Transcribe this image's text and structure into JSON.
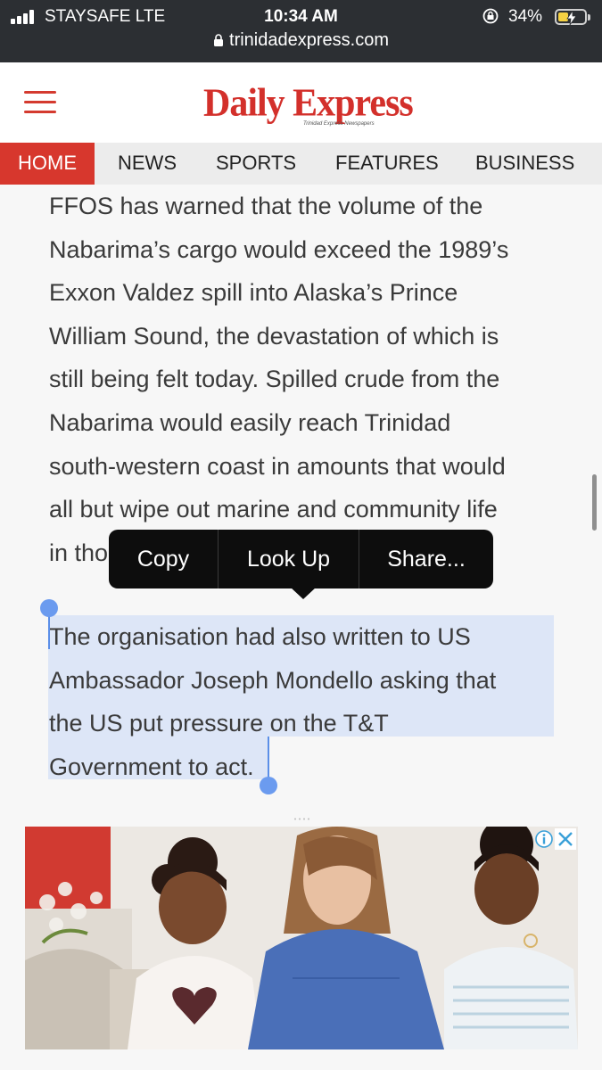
{
  "status_bar": {
    "carrier": "STAYSAFE  LTE",
    "time": "10:34 AM",
    "battery_percent": "34%",
    "battery_level": 0.34,
    "url": "trinidadexpress.com",
    "icons": [
      "signal-icon",
      "rotation-lock-icon",
      "battery-charging-icon",
      "padlock-icon"
    ]
  },
  "header": {
    "logo_text": "Daily Express",
    "logo_tagline": "Trinidad Express Newspapers",
    "menu_icon": "hamburger-icon",
    "brand_color": "#d3302b"
  },
  "nav": {
    "tabs": [
      {
        "label": "HOME",
        "active": true
      },
      {
        "label": "NEWS",
        "active": false
      },
      {
        "label": "SPORTS",
        "active": false
      },
      {
        "label": "FEATURES",
        "active": false
      },
      {
        "label": "BUSINESS",
        "active": false
      }
    ]
  },
  "article": {
    "paragraph1_lines": [
      "FFOS has warned that the volume of the",
      "Nabarima’s cargo would exceed the 1989’s",
      "Exxon Valdez spill into Alaska’s Prince",
      "William Sound, the devastation of which is",
      "still being felt today. Spilled crude from the",
      "Nabarima would easily reach Trinidad",
      "south-western coast in amounts that would",
      "all but wipe out marine and community life",
      "in tho"
    ],
    "paragraph2_lines": [
      "The organisation had also written to US",
      "Ambassador Joseph Mondello asking that",
      "the US put pressure on the T&T",
      "Government to act."
    ],
    "selection_color": "#dde6f7"
  },
  "context_menu": {
    "items": [
      "Copy",
      "Look Up",
      "Share..."
    ]
  },
  "ad": {
    "icons": [
      "ad-info-icon",
      "ad-close-icon"
    ]
  }
}
